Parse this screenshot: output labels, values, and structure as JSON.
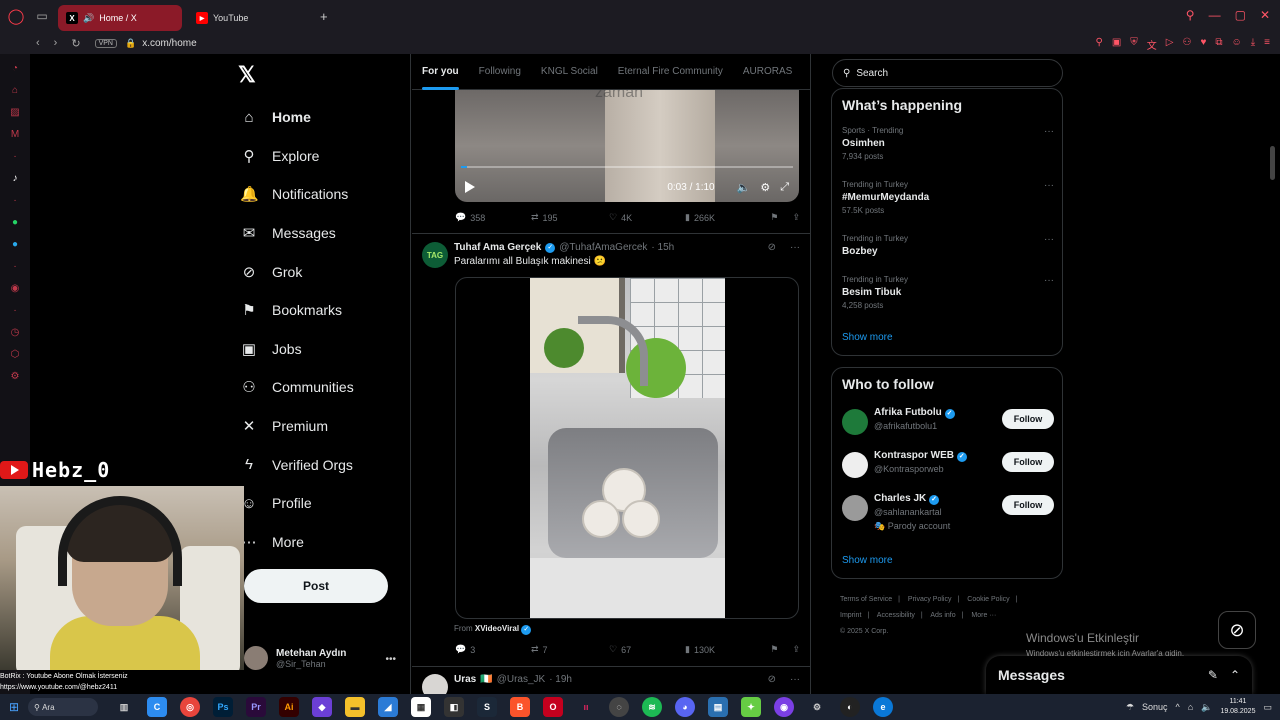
{
  "browser": {
    "tabs": [
      {
        "label": "Home / X",
        "active": true
      },
      {
        "label": "YouTube",
        "active": false
      }
    ],
    "vpn_label": "VPN",
    "url": "x.com/home"
  },
  "nav": {
    "items": [
      {
        "label": "Home",
        "icon": "home-icon",
        "glyph": "⌂"
      },
      {
        "label": "Explore",
        "icon": "search-icon",
        "glyph": "⚲"
      },
      {
        "label": "Notifications",
        "icon": "bell-icon",
        "glyph": "🔔"
      },
      {
        "label": "Messages",
        "icon": "envelope-icon",
        "glyph": "✉"
      },
      {
        "label": "Grok",
        "icon": "grok-icon",
        "glyph": "⊘"
      },
      {
        "label": "Bookmarks",
        "icon": "bookmark-icon",
        "glyph": "⚑"
      },
      {
        "label": "Jobs",
        "icon": "briefcase-icon",
        "glyph": "▣"
      },
      {
        "label": "Communities",
        "icon": "people-icon",
        "glyph": "⚇"
      },
      {
        "label": "Premium",
        "icon": "x-logo-icon",
        "glyph": "✕"
      },
      {
        "label": "Verified Orgs",
        "icon": "lightning-icon",
        "glyph": "ϟ"
      },
      {
        "label": "Profile",
        "icon": "person-icon",
        "glyph": "☺"
      },
      {
        "label": "More",
        "icon": "more-circle-icon",
        "glyph": "⋯"
      }
    ],
    "post_label": "Post",
    "account": {
      "name": "Metehan Aydın",
      "handle": "@Sir_Tehan"
    }
  },
  "overlay": {
    "channel": "Hebz_0",
    "chat": [
      "BotRix : Youtube Abone Olmak İsterseniz",
      "https://www.youtube.com/@hebz2411"
    ]
  },
  "feed": {
    "tabs": [
      "For you",
      "Following",
      "KNGL Social",
      "Eternal Fire Community",
      "AURORAS"
    ],
    "tweet1": {
      "watermark": "zaman",
      "video_time": "0:03 / 1:10",
      "replies": "358",
      "reposts": "195",
      "likes": "4K",
      "views": "266K"
    },
    "tweet2": {
      "avatar_text": "TAG",
      "name": "Tuhaf Ama Gerçek",
      "handle": "@TuhafAmaGercek",
      "time": "· 15h",
      "text": "Paralarımı all Bulaşık makinesi 😕",
      "from_prefix": "From",
      "from_source": "XVideoViral",
      "replies": "3",
      "reposts": "7",
      "likes": "67",
      "views": "130K"
    },
    "tweet3": {
      "name": "Uras",
      "handle": "@Uras_JK",
      "time": "· 19h"
    }
  },
  "sidebar_right": {
    "search_placeholder": "Search",
    "whats_happening": {
      "title": "What’s happening",
      "trends": [
        {
          "meta": "Sports · Trending",
          "name": "Osimhen",
          "count": "7,934 posts"
        },
        {
          "meta": "Trending in Turkey",
          "name": "#MemurMeydanda",
          "count": "57.5K posts"
        },
        {
          "meta": "Trending in Turkey",
          "name": "Bozbey",
          "count": ""
        },
        {
          "meta": "Trending in Turkey",
          "name": "Besim Tibuk",
          "count": "4,258 posts"
        }
      ],
      "show_more": "Show more"
    },
    "who_to_follow": {
      "title": "Who to follow",
      "accounts": [
        {
          "name": "Afrika Futbolu",
          "handle": "@afrikafutbolu1",
          "extra": "",
          "button": "Follow"
        },
        {
          "name": "Kontraspor WEB",
          "handle": "@Kontrasporweb",
          "extra": "",
          "button": "Follow"
        },
        {
          "name": "Charles JK",
          "handle": "@sahlanankartal",
          "extra": "🎭 Parody account",
          "button": "Follow"
        }
      ],
      "show_more": "Show more"
    },
    "footer": [
      "Terms of Service",
      "|",
      "Privacy Policy",
      "|",
      "Cookie Policy",
      "|",
      "Imprint",
      "|",
      "Accessibility",
      "|",
      "Ads info",
      "|",
      "More ···",
      "© 2025 X Corp."
    ]
  },
  "windows_activation": {
    "title": "Windows'u Etkinleştir",
    "subtitle": "Windows'u etkinleştirmek için Ayarlar'a gidin."
  },
  "messages_drawer": {
    "label": "Messages"
  },
  "taskbar": {
    "search_label": "Ara",
    "weather": "Sonuç",
    "time": "11:41",
    "date": "19.08.2025"
  }
}
